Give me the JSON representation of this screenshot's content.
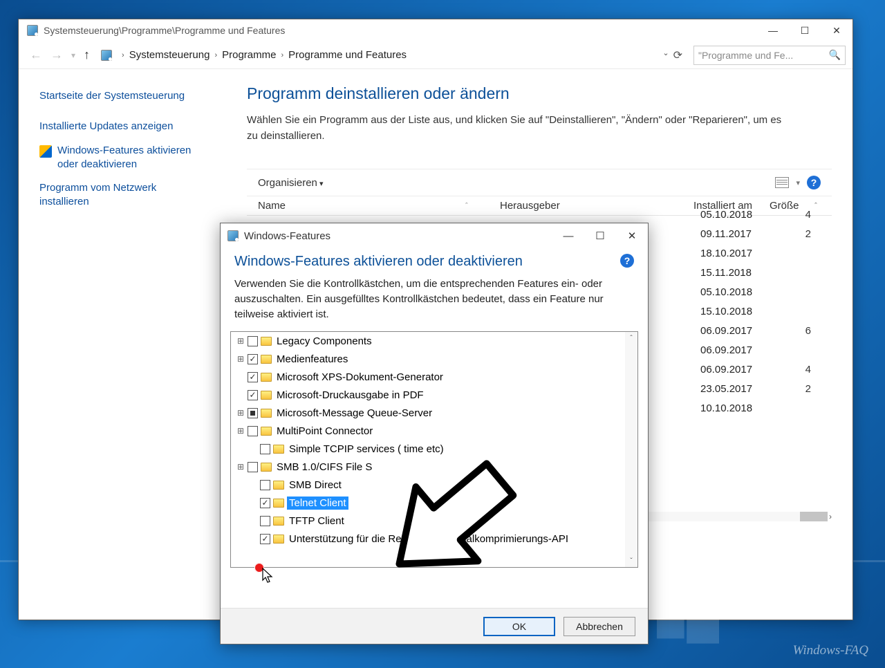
{
  "window": {
    "title_path": "Systemsteuerung\\Programme\\Programme und Features",
    "breadcrumbs": [
      "Systemsteuerung",
      "Programme",
      "Programme und Features"
    ],
    "search_placeholder": "\"Programme und Fe..."
  },
  "sidebar": {
    "items": [
      "Startseite der Systemsteuerung",
      "Installierte Updates anzeigen",
      "Windows-Features aktivieren oder deaktivieren",
      "Programm vom Netzwerk installieren"
    ]
  },
  "main": {
    "heading": "Programm deinstallieren oder ändern",
    "description": "Wählen Sie ein Programm aus der Liste aus, und klicken Sie auf \"Deinstallieren\", \"Ändern\" oder \"Reparieren\", um es zu deinstallieren.",
    "organize_label": "Organisieren",
    "columns": {
      "name": "Name",
      "publisher": "Herausgeber",
      "installed": "Installiert am",
      "size": "Größe"
    },
    "rows": [
      {
        "date": "05.10.2018",
        "size": "4"
      },
      {
        "date": "09.11.2017",
        "size": "2"
      },
      {
        "date": "18.10.2017",
        "size": ""
      },
      {
        "date": "15.11.2018",
        "size": ""
      },
      {
        "date": "05.10.2018",
        "size": ""
      },
      {
        "date": "15.10.2018",
        "size": ""
      },
      {
        "date": "06.09.2017",
        "size": "6"
      },
      {
        "date": "06.09.2017",
        "size": ""
      },
      {
        "date": "06.09.2017",
        "size": "4"
      },
      {
        "date": "23.05.2017",
        "size": "2"
      },
      {
        "date": "10.10.2018",
        "size": ""
      }
    ]
  },
  "dialog": {
    "title": "Windows-Features",
    "heading": "Windows-Features aktivieren oder deaktivieren",
    "description": "Verwenden Sie die Kontrollkästchen, um die entsprechenden Features ein- oder auszuschalten. Ein ausgefülltes Kontrollkästchen bedeutet, dass ein Feature nur teilweise aktiviert ist.",
    "items": [
      {
        "exp": "+",
        "cb": "off",
        "label": "Legacy Components"
      },
      {
        "exp": "+",
        "cb": "on",
        "label": "Medienfeatures"
      },
      {
        "exp": "",
        "cb": "on",
        "label": "Microsoft XPS-Dokument-Generator"
      },
      {
        "exp": "",
        "cb": "on",
        "label": "Microsoft-Druckausgabe in PDF"
      },
      {
        "exp": "+",
        "cb": "sq",
        "label": "Microsoft-Message Queue-Server"
      },
      {
        "exp": "+",
        "cb": "off",
        "label": "MultiPoint Connector"
      },
      {
        "exp": "",
        "cb": "off",
        "indent": 1,
        "label": "Simple TCPIP services (                     time etc)"
      },
      {
        "exp": "+",
        "cb": "off",
        "label": "SMB 1.0/CIFS File S"
      },
      {
        "exp": "",
        "cb": "off",
        "indent": 1,
        "label": "SMB Direct"
      },
      {
        "exp": "",
        "cb": "on",
        "indent": 1,
        "label": "Telnet Client",
        "selected": true
      },
      {
        "exp": "",
        "cb": "off",
        "indent": 1,
        "label": "TFTP Client"
      },
      {
        "exp": "",
        "cb": "on",
        "indent": 1,
        "label": "Unterstützung für die Remotedifferenzialkomprimierungs-API"
      }
    ],
    "ok": "OK",
    "cancel": "Abbrechen"
  },
  "watermark": "Windows-FAQ"
}
